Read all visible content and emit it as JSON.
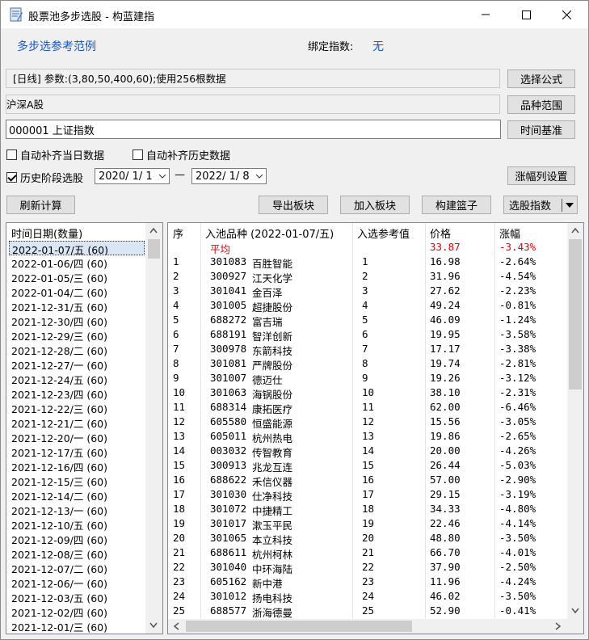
{
  "window": {
    "title": "股票池多步选股 - 构蓝建指",
    "minimize": "minimize",
    "maximize": "maximize",
    "close": "close"
  },
  "header": {
    "link_text": "多步选参考范例",
    "bind_label": "绑定指数:",
    "bind_value": "无"
  },
  "formula_line": "[日线] 参数:(3,80,50,400,60);使用256根数据",
  "range_line": "沪深A股",
  "index_input_value": "000001 上证指数",
  "buttons": {
    "select_formula": "选择公式",
    "variety_range": "品种范围",
    "time_base": "时间基准",
    "change_cols": "涨幅列设置",
    "refresh": "刷新计算",
    "export_block": "导出板块",
    "add_block": "加入板块",
    "build_basket": "构建篮子",
    "select_index": "选股指数"
  },
  "checks": {
    "auto_today": {
      "label": "自动补齐当日数据",
      "checked": false
    },
    "auto_history": {
      "label": "自动补齐历史数据",
      "checked": false
    },
    "history_stage": {
      "label": "历史阶段选股",
      "checked": true
    }
  },
  "date_from": "2020/ 1/ 1",
  "date_sep": "—",
  "date_to": "2022/ 1/ 8",
  "dates_header": "时间日期(数量)",
  "dates": [
    "2022-01-07/五  (60)",
    "2022-01-06/四  (60)",
    "2022-01-05/三  (60)",
    "2022-01-04/二  (60)",
    "2021-12-31/五  (60)",
    "2021-12-30/四  (60)",
    "2021-12-29/三  (60)",
    "2021-12-28/二  (60)",
    "2021-12-27/一  (60)",
    "2021-12-24/五  (60)",
    "2021-12-23/四  (60)",
    "2021-12-22/三  (60)",
    "2021-12-21/二  (60)",
    "2021-12-20/一  (60)",
    "2021-12-17/五  (60)",
    "2021-12-16/四  (60)",
    "2021-12-15/三  (60)",
    "2021-12-14/二  (60)",
    "2021-12-13/一  (60)",
    "2021-12-10/五  (60)",
    "2021-12-09/四  (60)",
    "2021-12-08/三  (60)",
    "2021-12-07/二  (60)",
    "2021-12-06/一  (60)",
    "2021-12-03/五  (60)",
    "2021-12-02/四  (60)",
    "2021-12-01/三  (60)"
  ],
  "table": {
    "headers": [
      "序",
      "入池品种 (2022-01-07/五)",
      "入选参考值",
      "价格",
      "涨幅"
    ],
    "avg": {
      "label": "平均",
      "price": "33.87",
      "change": "-3.43%"
    },
    "rows": [
      [
        "1",
        "301083",
        "百胜智能",
        "1",
        "16.98",
        "-2.64%"
      ],
      [
        "2",
        "300927",
        "江天化学",
        "2",
        "31.96",
        "-4.54%"
      ],
      [
        "3",
        "301041",
        "金百泽",
        "3",
        "27.62",
        "-2.23%"
      ],
      [
        "4",
        "301005",
        "超捷股份",
        "4",
        "49.24",
        "-0.81%"
      ],
      [
        "5",
        "688272",
        "富吉瑞",
        "5",
        "46.09",
        "-1.24%"
      ],
      [
        "6",
        "688191",
        "智洋创新",
        "6",
        "19.95",
        "-3.58%"
      ],
      [
        "7",
        "300978",
        "东箭科技",
        "7",
        "17.17",
        "-3.38%"
      ],
      [
        "8",
        "301081",
        "严牌股份",
        "8",
        "19.74",
        "-2.81%"
      ],
      [
        "9",
        "301007",
        "德迈仕",
        "9",
        "19.26",
        "-3.12%"
      ],
      [
        "10",
        "301063",
        "海锅股份",
        "10",
        "38.10",
        "-2.31%"
      ],
      [
        "11",
        "688314",
        "康拓医疗",
        "11",
        "62.00",
        "-6.46%"
      ],
      [
        "12",
        "605580",
        "恒盛能源",
        "12",
        "15.56",
        "-3.05%"
      ],
      [
        "13",
        "605011",
        "杭州热电",
        "13",
        "19.86",
        "-2.65%"
      ],
      [
        "14",
        "003032",
        "传智教育",
        "14",
        "20.00",
        "-4.26%"
      ],
      [
        "15",
        "300913",
        "兆龙互连",
        "15",
        "26.44",
        "-5.03%"
      ],
      [
        "16",
        "688622",
        "禾信仪器",
        "16",
        "57.00",
        "-2.90%"
      ],
      [
        "17",
        "301030",
        "仕净科技",
        "17",
        "29.15",
        "-3.19%"
      ],
      [
        "18",
        "301072",
        "中捷精工",
        "18",
        "34.33",
        "-4.80%"
      ],
      [
        "19",
        "301017",
        "漱玉平民",
        "19",
        "22.46",
        "-4.14%"
      ],
      [
        "20",
        "301065",
        "本立科技",
        "20",
        "48.80",
        "-3.50%"
      ],
      [
        "21",
        "688611",
        "杭州柯林",
        "21",
        "66.70",
        "-4.01%"
      ],
      [
        "22",
        "301040",
        "中环海陆",
        "22",
        "37.90",
        "-2.50%"
      ],
      [
        "23",
        "605162",
        "新中港",
        "23",
        "11.96",
        "-4.24%"
      ],
      [
        "24",
        "301012",
        "扬电科技",
        "24",
        "46.02",
        "-3.50%"
      ],
      [
        "25",
        "688577",
        "浙海德曼",
        "25",
        "52.90",
        "-0.41%"
      ]
    ]
  }
}
